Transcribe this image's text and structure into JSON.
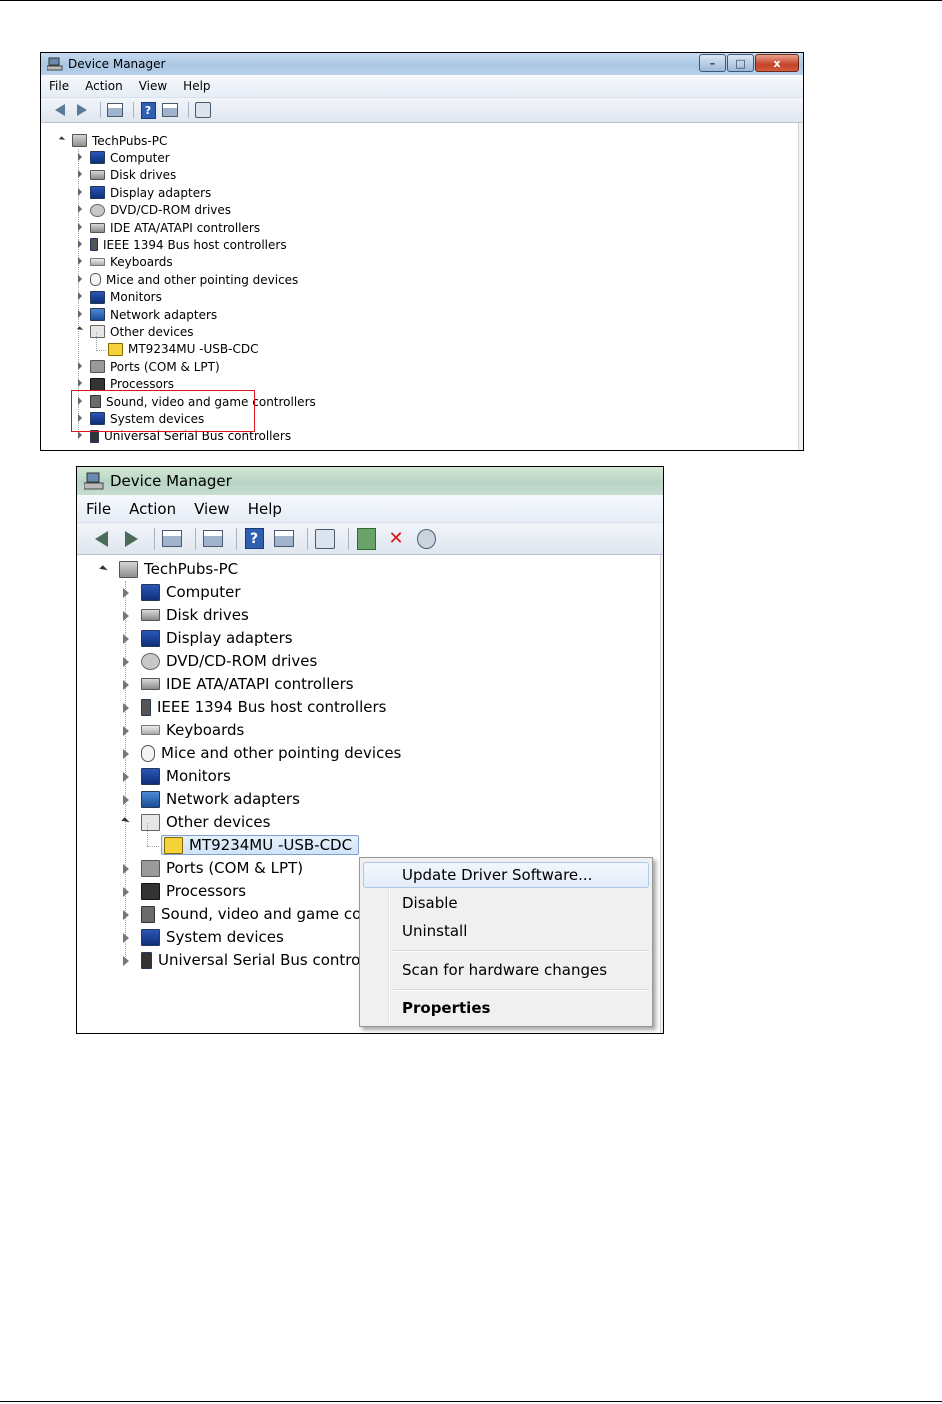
{
  "window_title": "Device Manager",
  "menu": [
    "File",
    "Action",
    "View",
    "Help"
  ],
  "window_buttons": {
    "minimize": "–",
    "maximize": "□",
    "close": "x"
  },
  "tree": {
    "root": "TechPubs-PC",
    "items": [
      {
        "label": "Computer",
        "icon": "computer-icon"
      },
      {
        "label": "Disk drives",
        "icon": "disk-drive-icon"
      },
      {
        "label": "Display adapters",
        "icon": "display-adapter-icon"
      },
      {
        "label": "DVD/CD-ROM drives",
        "icon": "dvd-drive-icon"
      },
      {
        "label": "IDE ATA/ATAPI controllers",
        "icon": "ide-controller-icon"
      },
      {
        "label": "IEEE 1394 Bus host controllers",
        "icon": "firewire-icon"
      },
      {
        "label": "Keyboards",
        "icon": "keyboard-icon"
      },
      {
        "label": "Mice and other pointing devices",
        "icon": "mouse-icon"
      },
      {
        "label": "Monitors",
        "icon": "monitor-icon"
      },
      {
        "label": "Network adapters",
        "icon": "network-adapter-icon"
      },
      {
        "label": "Other devices",
        "icon": "unknown-device-icon",
        "expanded": true
      },
      {
        "label": "MT9234MU -USB-CDC",
        "icon": "warning-device-icon",
        "child": true
      },
      {
        "label": "Ports (COM & LPT)",
        "icon": "port-icon"
      },
      {
        "label": "Processors",
        "icon": "processor-icon"
      },
      {
        "label": "Sound, video and game controllers",
        "icon": "sound-icon"
      },
      {
        "label": "System devices",
        "icon": "system-device-icon"
      },
      {
        "label": "Universal Serial Bus controllers",
        "icon": "usb-icon"
      }
    ]
  },
  "context_menu": {
    "items": [
      "Update Driver Software...",
      "Disable",
      "Uninstall",
      "Scan for hardware changes",
      "Properties"
    ]
  },
  "colors": {
    "highlight_box": "#e0141d",
    "selection": "#cfe3f9"
  }
}
